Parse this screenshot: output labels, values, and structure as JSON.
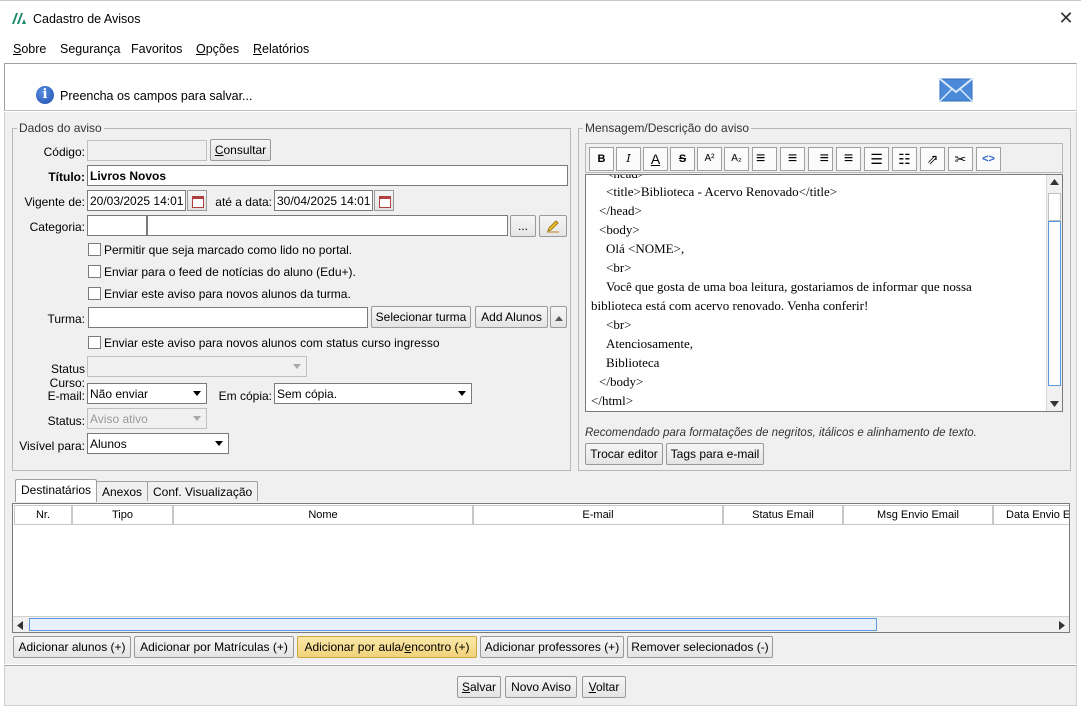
{
  "window": {
    "title": "Cadastro de Avisos",
    "close": "✕"
  },
  "menu": [
    {
      "pre": "",
      "u": "S",
      "post": "obre"
    },
    {
      "pre": "Segurança",
      "u": "",
      "post": ""
    },
    {
      "pre": "Favoritos",
      "u": "",
      "post": ""
    },
    {
      "pre": "",
      "u": "O",
      "post": "pções"
    },
    {
      "pre": "",
      "u": "R",
      "post": "elatórios"
    }
  ],
  "banner": {
    "info_icon": "i",
    "message": "Preencha os campos para salvar..."
  },
  "dados": {
    "legend": "Dados do aviso",
    "codigo_label": "Código:",
    "codigo_value": "",
    "consultar_pre": "",
    "consultar_u": "C",
    "consultar_post": "onsultar",
    "titulo_label": "Título:",
    "titulo_value": "Livros Novos",
    "vigente_label": "Vigente de:",
    "vigente_value": "20/03/2025 14:01",
    "ate_label": "até a data:",
    "ate_value": "30/04/2025 14:01",
    "categoria_label": "Categoria:",
    "categoria_code": "",
    "categoria_desc": "",
    "categoria_dots": "...",
    "check_portal": "Permitir que seja marcado como lido no portal.",
    "check_feed": "Enviar para o feed de notícias do aluno (Edu+).",
    "check_novos_turma": "Enviar este aviso para novos alunos da turma.",
    "turma_label": "Turma:",
    "turma_value": "",
    "selecionar_turma": "Selecionar turma",
    "add_alunos": "Add Alunos",
    "check_status_ingresso": "Enviar este aviso para novos alunos com status curso ingresso",
    "status_curso_label": "Status Curso:",
    "status_curso_value": "",
    "email_label": "E-mail:",
    "email_value": "Não enviar",
    "copia_label": "Em cópia:",
    "copia_value": "Sem cópia.",
    "status_label": "Status:",
    "status_value": "Aviso ativo",
    "visivel_label": "Visível para:",
    "visivel_value": "Alunos"
  },
  "mensagem": {
    "legend": "Mensagem/Descrição do aviso",
    "tools": [
      "B",
      "I",
      "A",
      "S",
      "A²",
      "A₂",
      "≡",
      "≡",
      "≡",
      "≡",
      "☰",
      "☷",
      "⇗",
      "✂",
      "<>"
    ],
    "lines": [
      "<head>",
      "<title>Biblioteca - Acervo Renovado</title>",
      "</head>",
      "<body>",
      "Olá <NOME>,",
      "<br>",
      "Você que gosta de uma boa leitura, gostariamos de informar que nossa",
      "biblioteca está com acervo renovado. Venha conferir!",
      "<br>",
      "Atenciosamente,",
      "Biblioteca",
      "</body>",
      "</html>"
    ],
    "hint": "Recomendado para formatações de negritos, itálicos e alinhamento de texto.",
    "trocar_editor": "Trocar editor",
    "tags_email": "Tags para e-mail"
  },
  "tabs": [
    "Destinatários",
    "Anexos",
    "Conf. Visualização"
  ],
  "grid": {
    "columns": [
      "Nr.",
      "Tipo",
      "Nome",
      "E-mail",
      "Status Email",
      "Msg Envio Email",
      "Data Envio Em"
    ]
  },
  "actions": {
    "add_alunos": "Adicionar alunos (+)",
    "add_matriculas": "Adicionar por Matrículas (+)",
    "add_aula_pre": "Adicionar por aula/",
    "add_aula_u": "e",
    "add_aula_post": "ncontro (+)",
    "add_professores": "Adicionar professores (+)",
    "remover": "Remover selecionados (-)"
  },
  "footer": {
    "salvar_pre": "",
    "salvar_u": "S",
    "salvar_post": "alvar",
    "novo_aviso": "Novo Aviso",
    "voltar_pre": "",
    "voltar_u": "V",
    "voltar_post": "oltar"
  },
  "colors": {
    "accent": "#2b79d0",
    "highlight_button": "#f1d27a",
    "mail_icon": "#3d7fd6"
  }
}
